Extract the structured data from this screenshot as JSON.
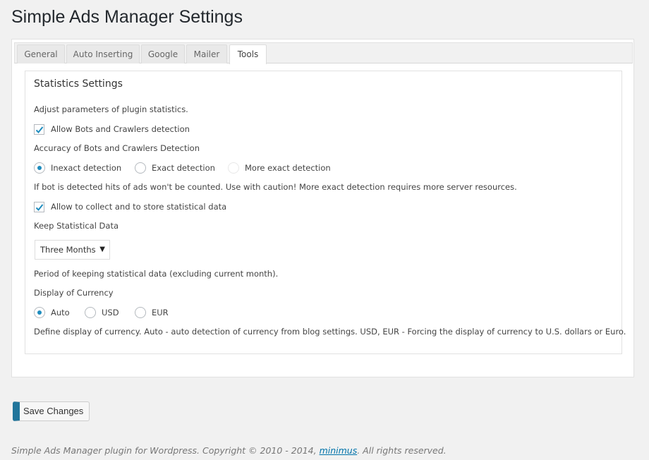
{
  "page": {
    "title": "Simple Ads Manager Settings"
  },
  "tabs": [
    {
      "label": "General"
    },
    {
      "label": "Auto Inserting"
    },
    {
      "label": "Google"
    },
    {
      "label": "Mailer"
    },
    {
      "label": "Tools",
      "active": true
    }
  ],
  "stats": {
    "title": "Statistics Settings",
    "intro": "Adjust parameters of plugin statistics.",
    "bots_checkbox": {
      "label": "Allow Bots and Crawlers detection",
      "checked": true
    },
    "accuracy_label": "Accuracy of Bots and Crawlers Detection",
    "accuracy_options": [
      "Inexact detection",
      "Exact detection",
      "More exact detection"
    ],
    "accuracy_selected": "Inexact detection",
    "accuracy_note": "If bot is detected hits of ads won't be counted. Use with caution! More exact detection requires more server resources.",
    "collect_checkbox": {
      "label": "Allow to collect and to store statistical data",
      "checked": true
    },
    "keep_label": "Keep Statistical Data",
    "keep_select": {
      "value": "Three Months"
    },
    "keep_note": "Period of keeping statistical data (excluding current month).",
    "currency_label": "Display of Currency",
    "currency_options": [
      "Auto",
      "USD",
      "EUR"
    ],
    "currency_selected": "Auto",
    "currency_note": "Define display of currency. Auto - auto detection of currency from blog settings. USD, EUR - Forcing the display of currency to U.S. dollars or Euro."
  },
  "actions": {
    "save_label": "Save Changes"
  },
  "footer": {
    "text_before": "Simple Ads Manager plugin for Wordpress. Copyright © 2010 - 2014, ",
    "link_text": "minimus",
    "text_after": ". All rights reserved."
  },
  "colors": {
    "accent": "#1e8cbe",
    "button_stripe": "#21759b",
    "link": "#0073aa"
  }
}
